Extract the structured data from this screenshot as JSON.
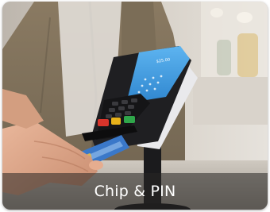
{
  "card": {
    "caption": "Chip & PIN",
    "image_subject": "hand inserting card into payment terminal",
    "terminal_screen_text": "$25.00"
  },
  "colors": {
    "caption_bar": "#28262480",
    "caption_text": "#ffffff",
    "terminal_body": "#1f1f22",
    "terminal_screen": "#4aa3e8",
    "key_red": "#d8342b",
    "key_yellow": "#e8b21a",
    "key_green": "#2fa64a",
    "card_blue": "#3a78c9"
  }
}
